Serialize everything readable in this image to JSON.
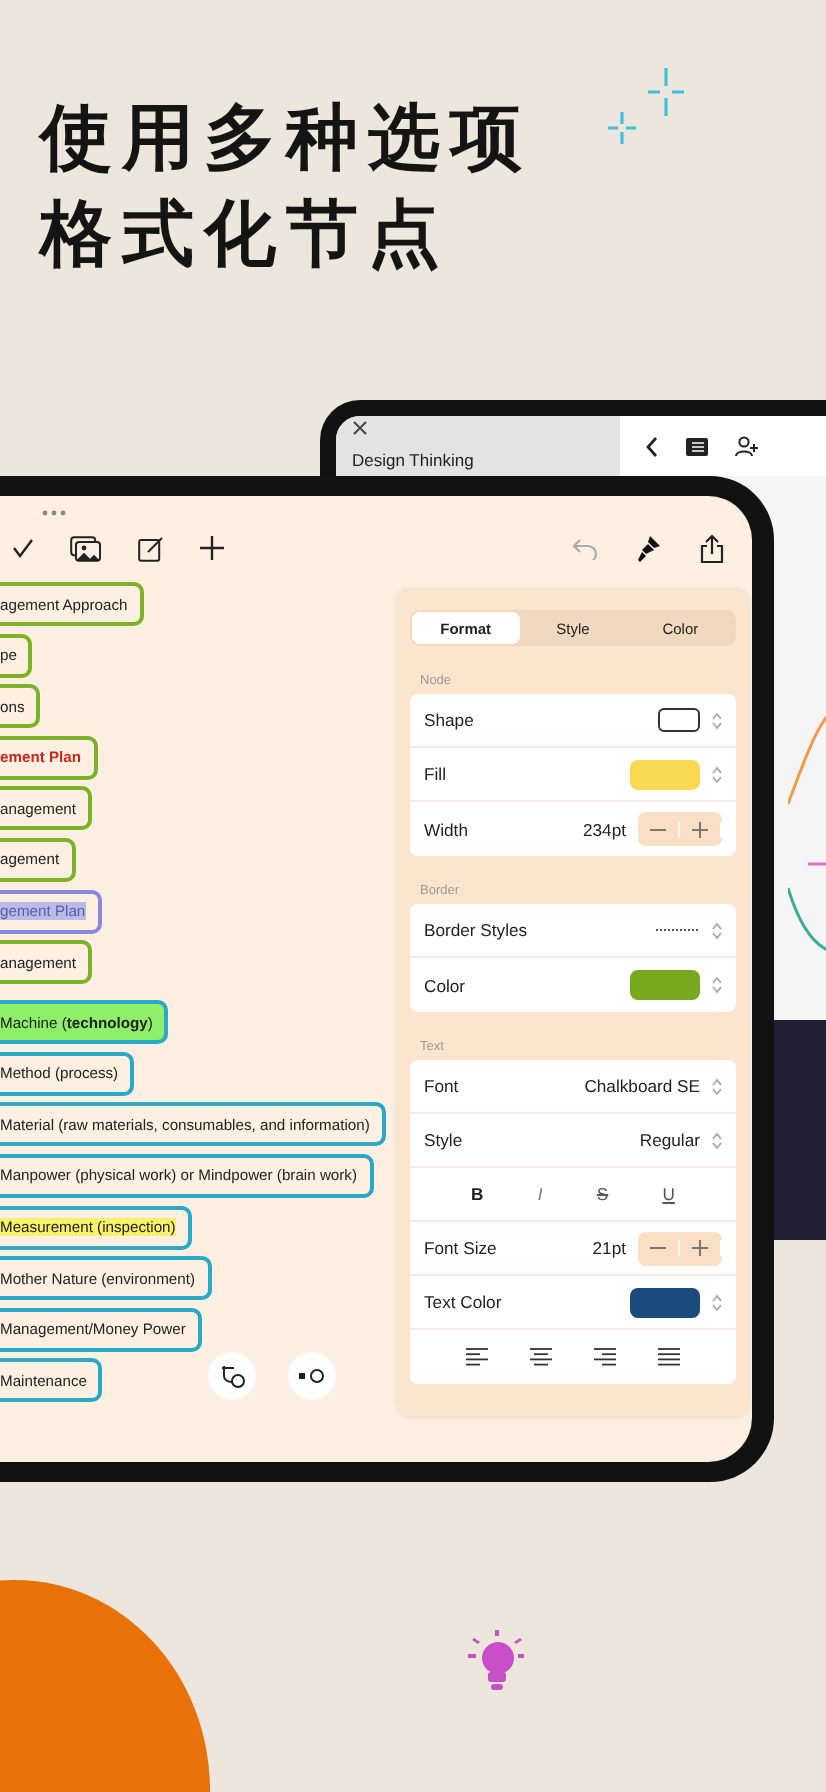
{
  "headline": [
    "使用多种选项",
    "格式化节点"
  ],
  "back_tablet": {
    "tab_title": "Design Thinking"
  },
  "branches": [
    {
      "color": "#7cb228",
      "nodes": [
        {
          "text": "agement Approach",
          "kind": "plain",
          "selected": false
        },
        {
          "text": "pe",
          "kind": "plain",
          "selected": false
        },
        {
          "text": "ons",
          "kind": "plain",
          "selected": false
        },
        {
          "text": "ement Plan",
          "kind": "alert",
          "selected": false
        },
        {
          "text": "anagement",
          "kind": "plain",
          "selected": false
        },
        {
          "text": "agement",
          "kind": "plain",
          "selected": false
        },
        {
          "text": "gement Plan",
          "kind": "plain",
          "selected": true
        },
        {
          "text": "anagement",
          "kind": "plain",
          "selected": false
        }
      ]
    },
    {
      "color": "#2aa9c6",
      "nodes": [
        {
          "text": "Machine (**technology**)",
          "kind": "filled",
          "selected": false
        },
        {
          "text": "Method (process)",
          "kind": "plain",
          "selected": false
        },
        {
          "text": "Material (raw materials, consumables, and information)",
          "kind": "plain",
          "selected": false
        },
        {
          "text": "Manpower (physical work) or Mindpower (brain work)",
          "kind": "plain",
          "selected": false
        },
        {
          "text": "Measurement (inspection)",
          "kind": "highlighted",
          "selected": false
        },
        {
          "text": "Mother Nature (environment)",
          "kind": "plain",
          "selected": false
        },
        {
          "text": "Management/Money Power",
          "kind": "plain",
          "selected": false
        },
        {
          "text": "Maintenance",
          "kind": "plain",
          "selected": false
        }
      ]
    }
  ],
  "panel": {
    "tabs": [
      {
        "label": "Format",
        "selected": true
      },
      {
        "label": "Style",
        "selected": false
      },
      {
        "label": "Color",
        "selected": false
      }
    ],
    "sections": [
      {
        "label": "Node",
        "rows": [
          {
            "kind": "shape",
            "label": "Shape"
          },
          {
            "kind": "swatch",
            "label": "Fill",
            "color": "#f9d94f"
          },
          {
            "kind": "stepper",
            "label": "Width",
            "value": "234pt"
          }
        ]
      },
      {
        "label": "Border",
        "rows": [
          {
            "kind": "border-style",
            "label": "Border Styles"
          },
          {
            "kind": "swatch",
            "label": "Color",
            "color": "#78a81e"
          }
        ]
      },
      {
        "label": "Text",
        "rows": [
          {
            "kind": "select",
            "label": "Font",
            "value": "Chalkboard SE"
          },
          {
            "kind": "select",
            "label": "Style",
            "value": "Regular"
          },
          {
            "kind": "format-buttons",
            "buttons": [
              {
                "label": "B",
                "kind": "bold"
              },
              {
                "label": "I",
                "kind": "italic"
              },
              {
                "label": "S",
                "kind": "strike"
              },
              {
                "label": "U",
                "kind": "underline"
              }
            ]
          },
          {
            "kind": "stepper",
            "label": "Font Size",
            "value": "21pt"
          },
          {
            "kind": "swatch",
            "label": "Text Color",
            "color": "#1b4a7c"
          },
          {
            "kind": "align-buttons"
          }
        ]
      }
    ]
  }
}
